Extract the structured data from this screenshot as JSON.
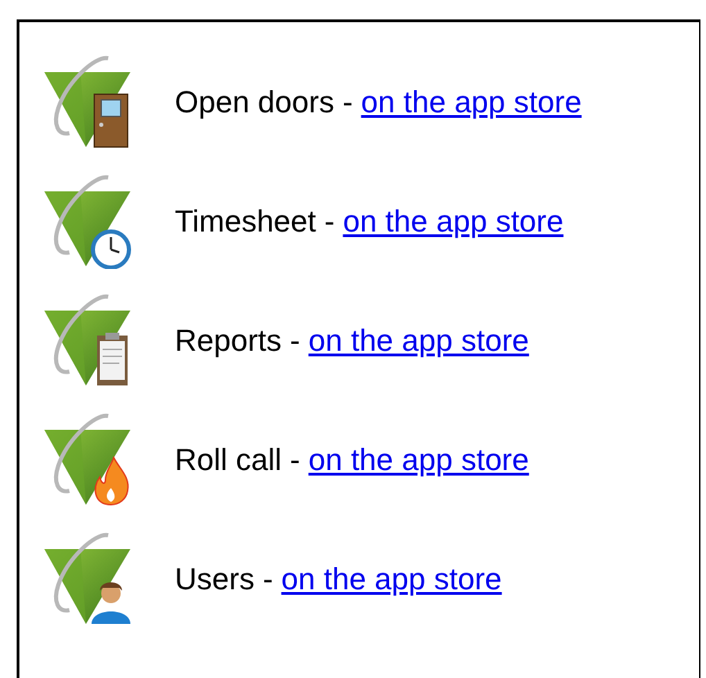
{
  "apps": [
    {
      "name": "Open doors",
      "separator": "-",
      "link": "on the app store"
    },
    {
      "name": "Timesheet",
      "separator": "-",
      "link": "on the app store"
    },
    {
      "name": "Reports",
      "separator": "-",
      "link": "on the app store"
    },
    {
      "name": "Roll call",
      "separator": "-",
      "link": "on the app store"
    },
    {
      "name": "Users",
      "separator": "-",
      "link": "on the app store"
    }
  ]
}
